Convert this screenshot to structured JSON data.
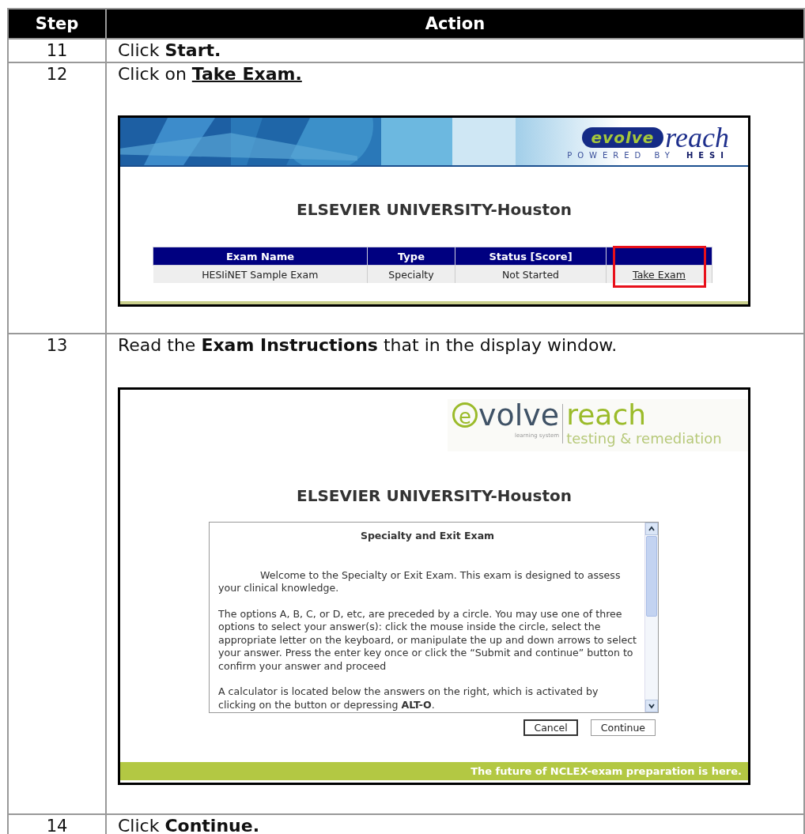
{
  "table": {
    "columns": [
      "Step",
      "Action"
    ],
    "rows": [
      {
        "step": "11",
        "instruction": "Click **Start.**",
        "emphasis_underlined": false
      },
      {
        "step": "12",
        "instruction": "Click on **Take Exam.**",
        "emphasis_underlined": true,
        "screenshot": {
          "kind": "exam_list",
          "logo": {
            "brand": "evolve",
            "product": "reach",
            "tagline": "POWERED BY",
            "tagline_brand": "HESI"
          },
          "heading": "ELSEVIER UNIVERSITY-Houston",
          "exam_table": {
            "columns": [
              "Exam Name",
              "Type",
              "Status [Score]"
            ],
            "rows": [
              {
                "exam_name": "HESIiNET Sample Exam",
                "type": "Specialty",
                "status": "Not Started",
                "action": "Take Exam",
                "highlighted": true
              }
            ]
          }
        }
      },
      {
        "step": "13",
        "instruction": "Read the **Exam Instructions** that in the display window.",
        "emphasis_underlined": false,
        "screenshot": {
          "kind": "instructions",
          "logo": {
            "brand": "evolve",
            "subtitle": "learning system",
            "product": "reach",
            "tagline": "testing & remediation"
          },
          "heading": "ELSEVIER UNIVERSITY-Houston",
          "dialog": {
            "title": "Specialty and Exit Exam",
            "paragraphs": [
              "Welcome to the Specialty or Exit Exam.  This exam is designed to assess your clinical knowledge.",
              "The options A, B, C, or D, etc, are preceded by a circle. You may use one of three options to select your answer(s): click the mouse inside the circle, select the appropriate letter on the keyboard, or manipulate the up and down arrows to select your answer. Press the enter key once or click the “Submit and continue” button to confirm your answer and proceed",
              "A calculator is located below the answers on the right, which is activated by clicking on the button or depressing **ALT-O**."
            ]
          },
          "buttons": [
            {
              "label": "Cancel",
              "focused": true
            },
            {
              "label": "Continue",
              "focused": false
            }
          ],
          "footer": "The future of NCLEX-exam preparation is here."
        }
      },
      {
        "step": "14",
        "instruction": "Click **Continue.**",
        "emphasis_underlined": false
      }
    ]
  }
}
